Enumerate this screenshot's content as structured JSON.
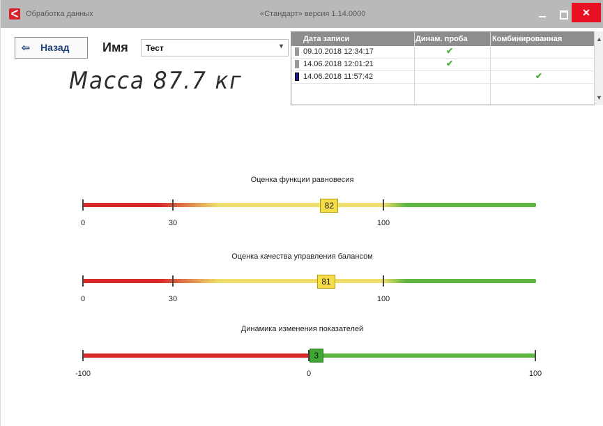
{
  "window": {
    "title_left": "Обработка данных",
    "title_center": "«Стандарт» версия 1.14.0000",
    "close_glyph": "✕"
  },
  "toolbar": {
    "back_label": "Назад",
    "back_icon": "⇦",
    "name_label": "Имя",
    "name_value": "Тест",
    "select_icon": "▾"
  },
  "mass_display": "Масса 87.7 кг",
  "records": {
    "headers": [
      "Дата записи",
      "Динам. проба",
      "Комбинированная"
    ],
    "rows": [
      {
        "date": "09.10.2018 12:34:17",
        "dyn": true,
        "comb": false
      },
      {
        "date": "14.06.2018 12:01:21",
        "dyn": true,
        "comb": false
      },
      {
        "date": "14.06.2018 11:57:42",
        "dyn": false,
        "comb": true
      }
    ],
    "check_glyph": "✔",
    "scroll_up": "▲",
    "scroll_down": "▼"
  },
  "scales": [
    {
      "title": "Оценка функции равновесия",
      "min": 0,
      "max": 150,
      "ticks": [
        0,
        30,
        100
      ],
      "tick_labels": [
        "0",
        "30",
        "100"
      ],
      "value": 82,
      "marker_label": "82",
      "colors": {
        "red": "#d62a2a",
        "yellow": "#eedd6a",
        "green": "#5cb640"
      }
    },
    {
      "title": "Оценка качества управления балансом",
      "min": 0,
      "max": 150,
      "ticks": [
        0,
        30,
        100
      ],
      "tick_labels": [
        "0",
        "30",
        "100"
      ],
      "value": 81,
      "marker_label": "81",
      "colors": {
        "red": "#d62a2a",
        "yellow": "#eedd6a",
        "green": "#5cb640"
      }
    },
    {
      "title": "Динамика изменения показателей",
      "min": -100,
      "max": 100,
      "ticks": [
        -100,
        0,
        100
      ],
      "tick_labels": [
        "-100",
        "0",
        "100"
      ],
      "value": 3,
      "marker_label": "3",
      "colors": {
        "red": "#d62a2a",
        "green": "#5cb640"
      }
    }
  ]
}
